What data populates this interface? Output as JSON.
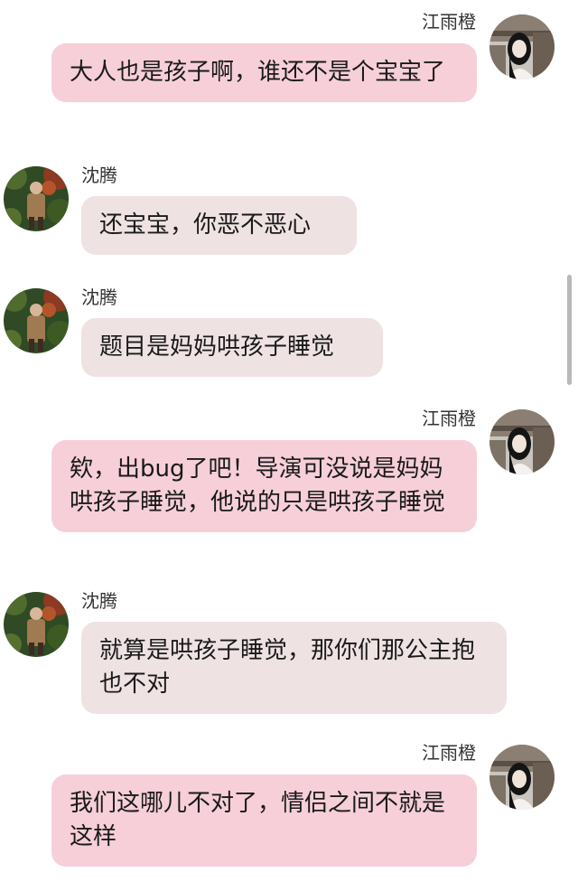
{
  "contacts": {
    "self": "江雨橙",
    "other": "沈腾"
  },
  "messages": [
    {
      "sender": "江雨橙",
      "side": "right",
      "text": "大人也是孩子啊，谁还不是个宝宝了"
    },
    {
      "sender": "沈腾",
      "side": "left",
      "text": "还宝宝，你恶不恶心"
    },
    {
      "sender": "沈腾",
      "side": "left",
      "text": "题目是妈妈哄孩子睡觉"
    },
    {
      "sender": "江雨橙",
      "side": "right",
      "text": "欸，出bug了吧！导演可没说是妈妈哄孩子睡觉，他说的只是哄孩子睡觉"
    },
    {
      "sender": "沈腾",
      "side": "left",
      "text": "就算是哄孩子睡觉，那你们那公主抱也不对"
    },
    {
      "sender": "江雨橙",
      "side": "right",
      "text": "我们这哪儿不对了，情侣之间不就是这样"
    }
  ],
  "colors": {
    "bubble_right": "#f6cfd9",
    "bubble_left": "#efe2e3"
  },
  "icons": {
    "avatar_self": "avatar-jiang-yucheng",
    "avatar_other": "avatar-shen-teng"
  }
}
